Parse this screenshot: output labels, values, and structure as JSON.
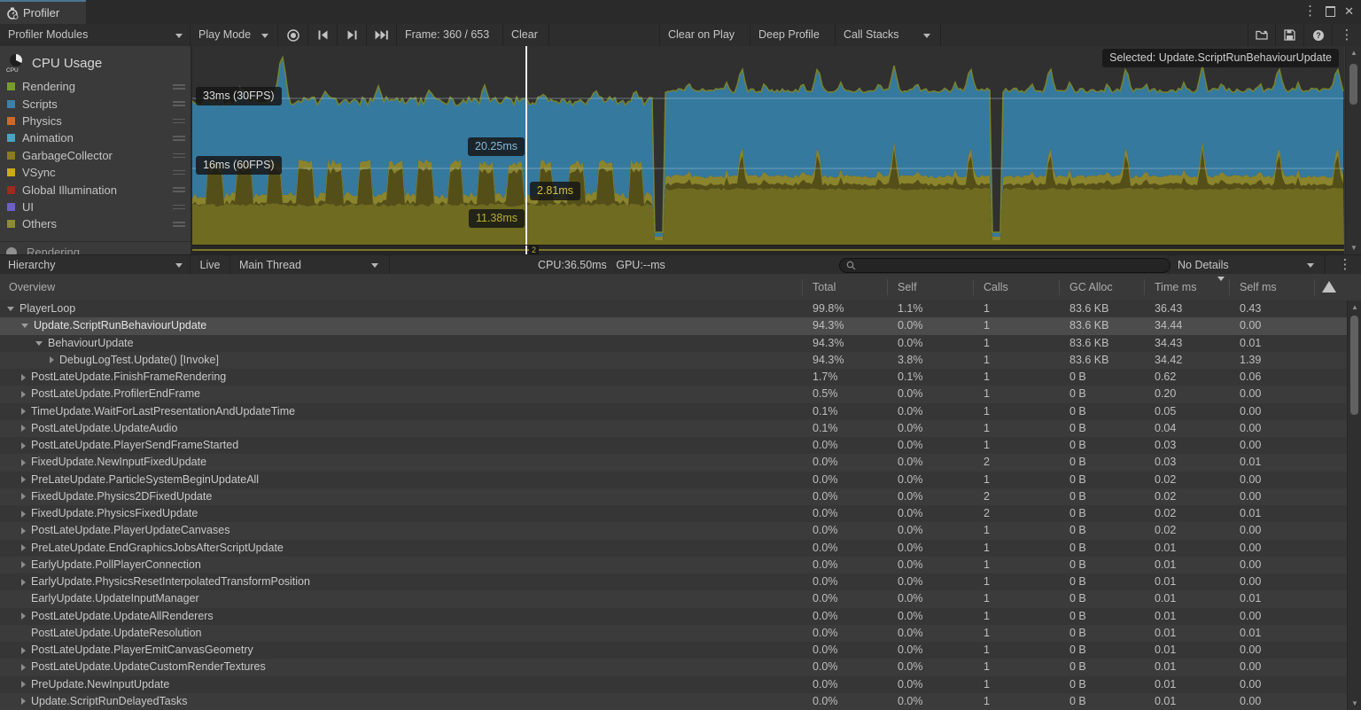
{
  "window": {
    "tab_title": "Profiler",
    "menu_icon": "kebab-menu",
    "maximize_icon": "maximize",
    "close_icon": "close"
  },
  "toolbar": {
    "modules_dropdown": "Profiler Modules",
    "play_mode": "Play Mode",
    "frame_label": "Frame: 360 / 653",
    "clear": "Clear",
    "clear_on_play": "Clear on Play",
    "deep_profile": "Deep Profile",
    "call_stacks": "Call Stacks"
  },
  "cpu_module": {
    "title": "CPU Usage",
    "legend": [
      {
        "label": "Rendering",
        "color": "#769C2E"
      },
      {
        "label": "Scripts",
        "color": "#3E7FA6"
      },
      {
        "label": "Physics",
        "color": "#CE6A28"
      },
      {
        "label": "Animation",
        "color": "#4BA3C3"
      },
      {
        "label": "GarbageCollector",
        "color": "#8A7B1E"
      },
      {
        "label": "VSync",
        "color": "#CDA91D"
      },
      {
        "label": "Global Illumination",
        "color": "#9E2A20"
      },
      {
        "label": "UI",
        "color": "#6C5FC7"
      },
      {
        "label": "Others",
        "color": "#8C8C33"
      }
    ],
    "next_module_title": "Rendering"
  },
  "chart": {
    "selected_label": "Selected: Update.ScriptRunBehaviourUpdate",
    "gridline_upper": "33ms (30FPS)",
    "gridline_lower": "16ms (60FPS)",
    "marker_scripts": "20.25ms",
    "marker_yellow": "2.81ms",
    "marker_olive": "11.38ms",
    "pan_marker": "2",
    "colors": {
      "scripts_area": "#35799E",
      "others_area": "#6F6B21",
      "vsync_dark": "#544F18",
      "vsync_bright": "#8A842D",
      "rendering_line": "#79832A",
      "background": "#303030",
      "current_frame_line": "#EDEDED"
    }
  },
  "hierarchy_bar": {
    "mode": "Hierarchy",
    "live": "Live",
    "thread": "Main Thread",
    "cpu_time": "CPU:36.50ms",
    "gpu_time": "GPU:--ms",
    "details": "No Details",
    "search_value": "",
    "search_placeholder": ""
  },
  "table": {
    "columns": [
      "Overview",
      "Total",
      "Self",
      "Calls",
      "GC Alloc",
      "Time ms",
      "Self ms"
    ],
    "rows": [
      {
        "name": "PlayerLoop",
        "indent": 0,
        "arrow": "exp",
        "selected": false,
        "values": [
          "99.8%",
          "1.1%",
          "1",
          "83.6 KB",
          "36.43",
          "0.43"
        ]
      },
      {
        "name": "Update.ScriptRunBehaviourUpdate",
        "indent": 1,
        "arrow": "exp",
        "selected": true,
        "values": [
          "94.3%",
          "0.0%",
          "1",
          "83.6 KB",
          "34.44",
          "0.00"
        ]
      },
      {
        "name": "BehaviourUpdate",
        "indent": 2,
        "arrow": "exp",
        "selected": false,
        "values": [
          "94.3%",
          "0.0%",
          "1",
          "83.6 KB",
          "34.43",
          "0.01"
        ]
      },
      {
        "name": "DebugLogTest.Update() [Invoke]",
        "indent": 3,
        "arrow": "col",
        "selected": false,
        "values": [
          "94.3%",
          "3.8%",
          "1",
          "83.6 KB",
          "34.42",
          "1.39"
        ]
      },
      {
        "name": "PostLateUpdate.FinishFrameRendering",
        "indent": 1,
        "arrow": "col",
        "selected": false,
        "values": [
          "1.7%",
          "0.1%",
          "1",
          "0 B",
          "0.62",
          "0.06"
        ]
      },
      {
        "name": "PostLateUpdate.ProfilerEndFrame",
        "indent": 1,
        "arrow": "col",
        "selected": false,
        "values": [
          "0.5%",
          "0.0%",
          "1",
          "0 B",
          "0.20",
          "0.00"
        ]
      },
      {
        "name": "TimeUpdate.WaitForLastPresentationAndUpdateTime",
        "indent": 1,
        "arrow": "col",
        "selected": false,
        "values": [
          "0.1%",
          "0.0%",
          "1",
          "0 B",
          "0.05",
          "0.00"
        ]
      },
      {
        "name": "PostLateUpdate.UpdateAudio",
        "indent": 1,
        "arrow": "col",
        "selected": false,
        "values": [
          "0.1%",
          "0.0%",
          "1",
          "0 B",
          "0.04",
          "0.00"
        ]
      },
      {
        "name": "PostLateUpdate.PlayerSendFrameStarted",
        "indent": 1,
        "arrow": "col",
        "selected": false,
        "values": [
          "0.0%",
          "0.0%",
          "1",
          "0 B",
          "0.03",
          "0.00"
        ]
      },
      {
        "name": "FixedUpdate.NewInputFixedUpdate",
        "indent": 1,
        "arrow": "col",
        "selected": false,
        "values": [
          "0.0%",
          "0.0%",
          "2",
          "0 B",
          "0.03",
          "0.01"
        ]
      },
      {
        "name": "PreLateUpdate.ParticleSystemBeginUpdateAll",
        "indent": 1,
        "arrow": "col",
        "selected": false,
        "values": [
          "0.0%",
          "0.0%",
          "1",
          "0 B",
          "0.02",
          "0.00"
        ]
      },
      {
        "name": "FixedUpdate.Physics2DFixedUpdate",
        "indent": 1,
        "arrow": "col",
        "selected": false,
        "values": [
          "0.0%",
          "0.0%",
          "2",
          "0 B",
          "0.02",
          "0.00"
        ]
      },
      {
        "name": "FixedUpdate.PhysicsFixedUpdate",
        "indent": 1,
        "arrow": "col",
        "selected": false,
        "values": [
          "0.0%",
          "0.0%",
          "2",
          "0 B",
          "0.02",
          "0.01"
        ]
      },
      {
        "name": "PostLateUpdate.PlayerUpdateCanvases",
        "indent": 1,
        "arrow": "col",
        "selected": false,
        "values": [
          "0.0%",
          "0.0%",
          "1",
          "0 B",
          "0.02",
          "0.00"
        ]
      },
      {
        "name": "PreLateUpdate.EndGraphicsJobsAfterScriptUpdate",
        "indent": 1,
        "arrow": "col",
        "selected": false,
        "values": [
          "0.0%",
          "0.0%",
          "1",
          "0 B",
          "0.01",
          "0.00"
        ]
      },
      {
        "name": "EarlyUpdate.PollPlayerConnection",
        "indent": 1,
        "arrow": "col",
        "selected": false,
        "values": [
          "0.0%",
          "0.0%",
          "1",
          "0 B",
          "0.01",
          "0.00"
        ]
      },
      {
        "name": "EarlyUpdate.PhysicsResetInterpolatedTransformPosition",
        "indent": 1,
        "arrow": "col",
        "selected": false,
        "values": [
          "0.0%",
          "0.0%",
          "1",
          "0 B",
          "0.01",
          "0.00"
        ]
      },
      {
        "name": "EarlyUpdate.UpdateInputManager",
        "indent": 1,
        "arrow": "none",
        "selected": false,
        "values": [
          "0.0%",
          "0.0%",
          "1",
          "0 B",
          "0.01",
          "0.01"
        ]
      },
      {
        "name": "PostLateUpdate.UpdateAllRenderers",
        "indent": 1,
        "arrow": "col",
        "selected": false,
        "values": [
          "0.0%",
          "0.0%",
          "1",
          "0 B",
          "0.01",
          "0.00"
        ]
      },
      {
        "name": "PostLateUpdate.UpdateResolution",
        "indent": 1,
        "arrow": "none",
        "selected": false,
        "values": [
          "0.0%",
          "0.0%",
          "1",
          "0 B",
          "0.01",
          "0.01"
        ]
      },
      {
        "name": "PostLateUpdate.PlayerEmitCanvasGeometry",
        "indent": 1,
        "arrow": "col",
        "selected": false,
        "values": [
          "0.0%",
          "0.0%",
          "1",
          "0 B",
          "0.01",
          "0.00"
        ]
      },
      {
        "name": "PostLateUpdate.UpdateCustomRenderTextures",
        "indent": 1,
        "arrow": "col",
        "selected": false,
        "values": [
          "0.0%",
          "0.0%",
          "1",
          "0 B",
          "0.01",
          "0.00"
        ]
      },
      {
        "name": "PreUpdate.NewInputUpdate",
        "indent": 1,
        "arrow": "col",
        "selected": false,
        "values": [
          "0.0%",
          "0.0%",
          "1",
          "0 B",
          "0.01",
          "0.00"
        ]
      },
      {
        "name": "Update.ScriptRunDelayedTasks",
        "indent": 1,
        "arrow": "col",
        "selected": false,
        "values": [
          "0.0%",
          "0.0%",
          "1",
          "0 B",
          "0.01",
          "0.00"
        ]
      }
    ]
  }
}
